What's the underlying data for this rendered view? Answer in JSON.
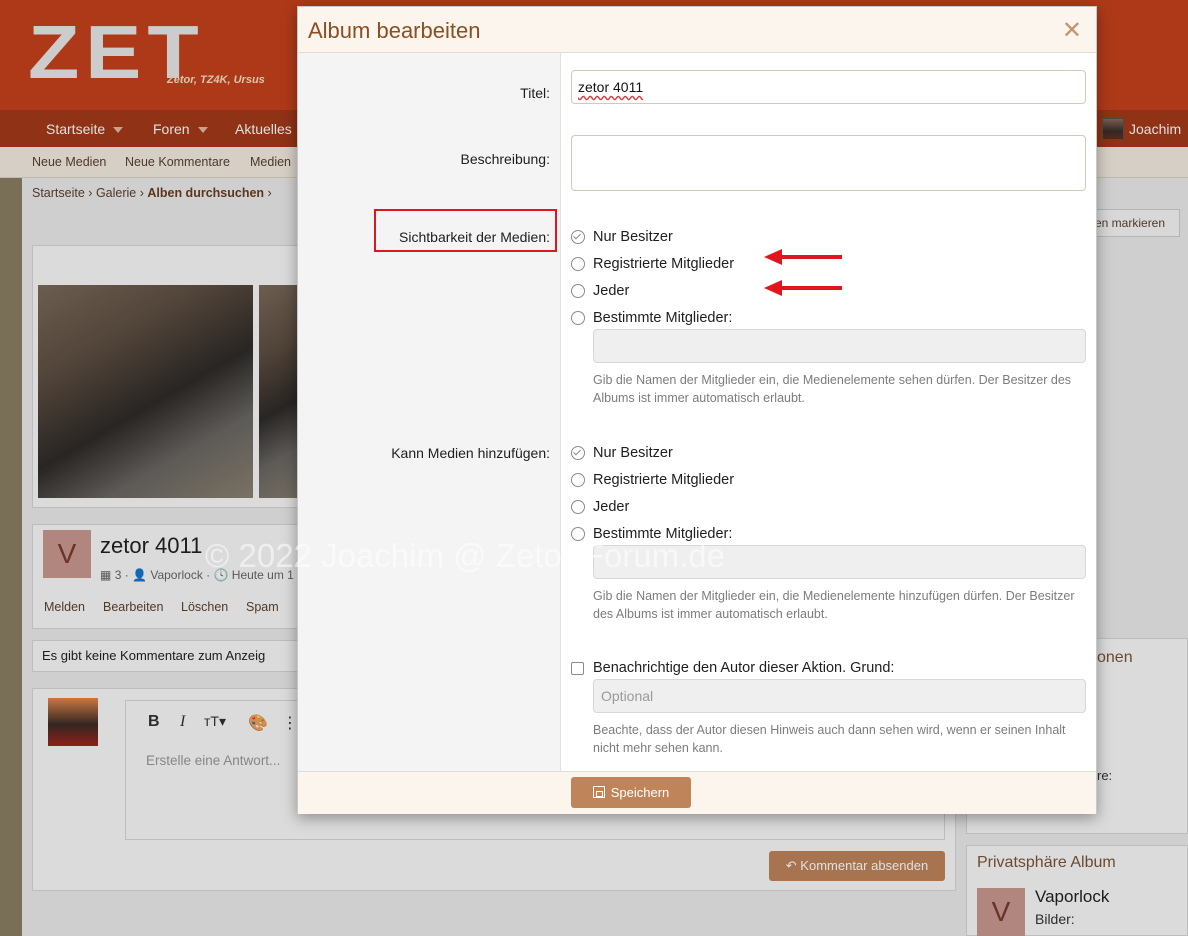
{
  "background": {
    "logo_text": "ZET",
    "logo_sub": "Zetor, TZ4K, Ursus",
    "nav": [
      {
        "label": "Startseite"
      },
      {
        "label": "Foren"
      },
      {
        "label": "Aktuelles"
      }
    ],
    "user_name": "Joachim",
    "subnav": [
      "Neue Medien",
      "Neue Kommentare",
      "Medien"
    ],
    "breadcrumb": {
      "first": "Startseite",
      "second": "Galerie",
      "current": "Alben durchsuchen"
    },
    "markieren": "en markieren",
    "album": {
      "avatar_letter": "V",
      "title": "zetor 4011",
      "meta_count": "3",
      "meta_author": "Vaporlock",
      "meta_date": "Heute um 1"
    },
    "actions": [
      "Melden",
      "Bearbeiten",
      "Löschen",
      "Spam"
    ],
    "no_comments": "Es gibt keine Kommentare zum Anzeig",
    "reply_placeholder": "Erstelle eine Antwort...",
    "submit_comment": "Kommentar absenden",
    "side_label_1": "onen",
    "side_label_2": "re:",
    "privacy_title": "Privatsphäre Album",
    "owner_name": "Vaporlock",
    "owner_pics_label": "Bilder:",
    "watermark": "© 2022 Joachim @ Zetor-Forum.de"
  },
  "modal": {
    "title": "Album bearbeiten",
    "close_symbol": "✕",
    "fields": {
      "title_label": "Titel:",
      "title_value": "zetor 4011",
      "description_label": "Beschreibung:",
      "description_value": "",
      "visibility_label": "Sichtbarkeit der Medien:",
      "visibility_options": [
        "Nur Besitzer",
        "Registrierte Mitglieder",
        "Jeder",
        "Bestimmte Mitglieder:"
      ],
      "visibility_selected": "Nur Besitzer",
      "visibility_hint": "Gib die Namen der Mitglieder ein, die Medienelemente sehen dürfen. Der Besitzer des Albums ist immer automatisch erlaubt.",
      "add_label": "Kann Medien hinzufügen:",
      "add_options": [
        "Nur Besitzer",
        "Registrierte Mitglieder",
        "Jeder",
        "Bestimmte Mitglieder:"
      ],
      "add_selected": "Nur Besitzer",
      "add_hint": "Gib die Namen der Mitglieder ein, die Medienelemente hinzufügen dürfen. Der Besitzer des Albums ist immer automatisch erlaubt.",
      "notify_label": "Benachrichtige den Autor dieser Aktion. Grund:",
      "notify_checked": false,
      "reason_placeholder": "Optional",
      "notify_hint": "Beachte, dass der Autor diesen Hinweis auch dann sehen wird, wenn er seinen Inhalt nicht mehr sehen kann."
    },
    "save_label": "Speichern"
  },
  "annotation_color": "#e0161d",
  "accent_color": "#c0845a"
}
